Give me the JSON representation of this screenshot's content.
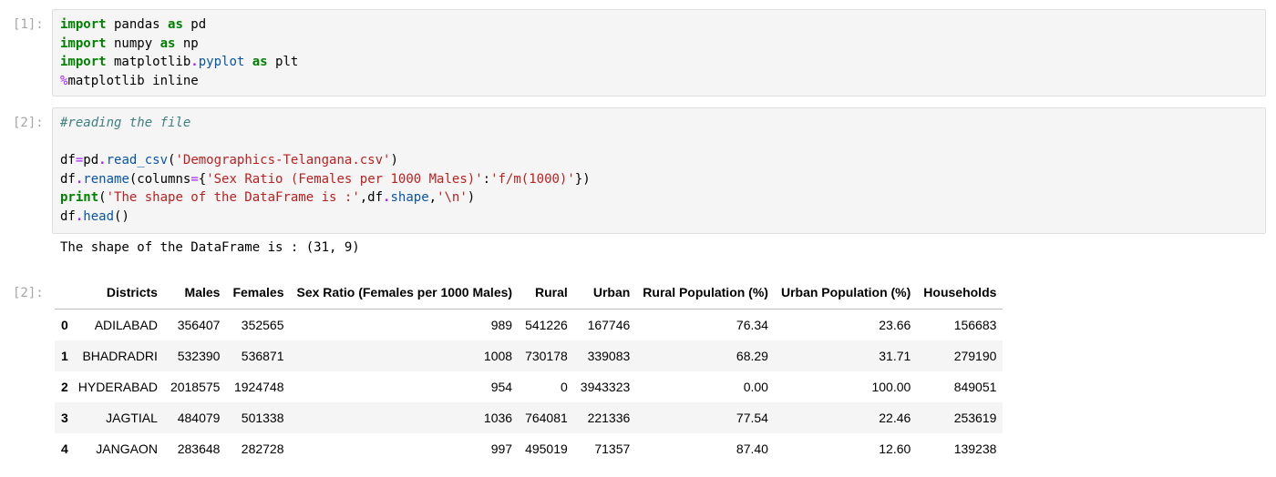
{
  "cells": [
    {
      "prompt": "[1]:",
      "lines": [
        [
          [
            "kw",
            "import"
          ],
          [
            "plain",
            " pandas "
          ],
          [
            "kw",
            "as"
          ],
          [
            "plain",
            " pd"
          ]
        ],
        [
          [
            "kw",
            "import"
          ],
          [
            "plain",
            " numpy "
          ],
          [
            "kw",
            "as"
          ],
          [
            "plain",
            " np"
          ]
        ],
        [
          [
            "kw",
            "import"
          ],
          [
            "plain",
            " matplotlib"
          ],
          [
            "opb",
            "."
          ],
          [
            "attr",
            "pyplot"
          ],
          [
            "plain",
            " "
          ],
          [
            "kw",
            "as"
          ],
          [
            "plain",
            " plt"
          ]
        ],
        [
          [
            "op",
            "%"
          ],
          [
            "plain",
            "matplotlib inline"
          ]
        ]
      ]
    },
    {
      "prompt": "[2]:",
      "lines": [
        [
          [
            "cm",
            "#reading the file"
          ]
        ],
        [
          [
            "plain",
            ""
          ]
        ],
        [
          [
            "plain",
            "df"
          ],
          [
            "op",
            "="
          ],
          [
            "plain",
            "pd"
          ],
          [
            "opb",
            "."
          ],
          [
            "attr",
            "read_csv"
          ],
          [
            "plain",
            "("
          ],
          [
            "str",
            "'Demographics-Telangana.csv'"
          ],
          [
            "plain",
            ")"
          ]
        ],
        [
          [
            "plain",
            "df"
          ],
          [
            "opb",
            "."
          ],
          [
            "attr",
            "rename"
          ],
          [
            "plain",
            "(columns"
          ],
          [
            "op",
            "="
          ],
          [
            "plain",
            "{"
          ],
          [
            "str",
            "'Sex Ratio (Females per 1000 Males)'"
          ],
          [
            "plain",
            ":"
          ],
          [
            "str",
            "'f/m(1000)'"
          ],
          [
            "plain",
            "})"
          ]
        ],
        [
          [
            "kw",
            "print"
          ],
          [
            "plain",
            "("
          ],
          [
            "str",
            "'The shape of the DataFrame is :'"
          ],
          [
            "plain",
            ",df"
          ],
          [
            "opb",
            "."
          ],
          [
            "attr",
            "shape"
          ],
          [
            "plain",
            ","
          ],
          [
            "str",
            "'\\n'"
          ],
          [
            "plain",
            ")"
          ]
        ],
        [
          [
            "plain",
            "df"
          ],
          [
            "opb",
            "."
          ],
          [
            "attr",
            "head"
          ],
          [
            "plain",
            "()"
          ]
        ]
      ]
    }
  ],
  "stdout": "The shape of the DataFrame is : (31, 9)",
  "output_prompt": "[2]:",
  "table": {
    "columns": [
      "",
      "Districts",
      "Males",
      "Females",
      "Sex Ratio (Females per 1000 Males)",
      "Rural",
      "Urban",
      "Rural Population (%)",
      "Urban Population (%)",
      "Households"
    ],
    "rows": [
      [
        "0",
        "ADILABAD",
        "356407",
        "352565",
        "989",
        "541226",
        "167746",
        "76.34",
        "23.66",
        "156683"
      ],
      [
        "1",
        "BHADRADRI",
        "532390",
        "536871",
        "1008",
        "730178",
        "339083",
        "68.29",
        "31.71",
        "279190"
      ],
      [
        "2",
        "HYDERABAD",
        "2018575",
        "1924748",
        "954",
        "0",
        "3943323",
        "0.00",
        "100.00",
        "849051"
      ],
      [
        "3",
        "JAGTIAL",
        "484079",
        "501338",
        "1036",
        "764081",
        "221336",
        "77.54",
        "22.46",
        "253619"
      ],
      [
        "4",
        "JANGAON",
        "283648",
        "282728",
        "997",
        "495019",
        "71357",
        "87.40",
        "12.60",
        "139238"
      ]
    ]
  }
}
